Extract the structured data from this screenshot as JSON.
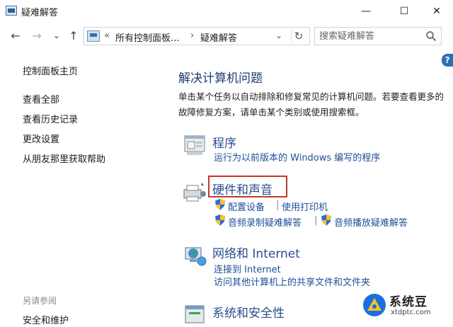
{
  "window": {
    "title": "疑难解答",
    "controls": {
      "minimize": "—",
      "maximize": "☐",
      "close": "✕"
    }
  },
  "nav": {
    "back_icon": "←",
    "forward_icon": "→",
    "recent_icon": "⌄",
    "up_icon": "↑",
    "breadcrumb_prefix": "«",
    "breadcrumb": [
      "所有控制面板...",
      "疑难解答"
    ],
    "crumb_sep": "›",
    "dropdown_icon": "⌄",
    "refresh_icon": "↻",
    "search_placeholder": "搜索疑难解答"
  },
  "sidebar": {
    "items": [
      {
        "label": "控制面板主页"
      },
      {
        "label": "查看全部"
      },
      {
        "label": "查看历史记录"
      },
      {
        "label": "更改设置"
      },
      {
        "label": "从朋友那里获取帮助"
      }
    ],
    "see_also_title": "另请参阅",
    "see_also_item": "安全和维护"
  },
  "main": {
    "heading": "解决计算机问题",
    "description": "单击某个任务以自动排除和修复常见的计算机问题。若要查看更多的故障修复方案，请单击某个类别或使用搜索框。",
    "categories": {
      "programs": {
        "title": "程序",
        "link": "运行为以前版本的 Windows 编写的程序"
      },
      "hardware": {
        "title": "硬件和声音",
        "link1": "配置设备",
        "link2": "使用打印机",
        "link3": "音频录制疑难解答",
        "link4": "音频播放疑难解答",
        "separator": "|"
      },
      "network": {
        "title": "网络和 Internet",
        "link1": "连接到 Internet",
        "link2": "访问其他计算机上的共享文件和文件夹"
      },
      "security": {
        "title": "系统和安全性"
      }
    }
  },
  "help_button": "?",
  "watermark": {
    "name": "系统豆",
    "url": "xtdptc.com"
  },
  "colors": {
    "heading": "#1e3b70",
    "link": "#1f4e99",
    "highlight_box": "#c0392b",
    "help": "#2a6fb8"
  }
}
